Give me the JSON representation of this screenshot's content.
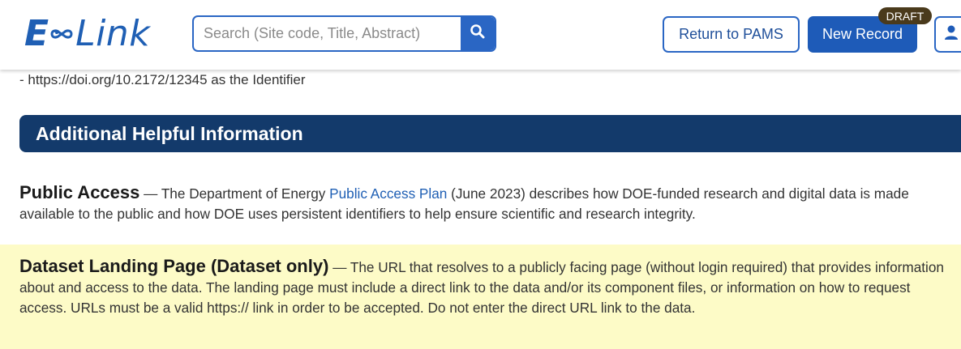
{
  "header": {
    "logo_e": "E",
    "logo_link": "Link",
    "search_placeholder": "Search (Site code, Title, Abstract)",
    "return_label": "Return to PAMS",
    "new_record_label": "New Record",
    "draft_badge": "DRAFT",
    "icons": [
      "infinity-logo-icon",
      "search-icon",
      "user-icon"
    ]
  },
  "content": {
    "doi_line": "- https://doi.org/10.2172/12345 as the Identifier",
    "section_title": "Additional Helpful Information",
    "public_access": {
      "term": "Public Access",
      "sep": " — ",
      "text_before": "The Department of Energy ",
      "link": "Public Access Plan",
      "text_after": " (June 2023) describes how DOE-funded research and digital data is made available to the public and how DOE uses persistent identifiers to help ensure scientific and research integrity."
    },
    "landing_page": {
      "term": "Dataset Landing Page (Dataset only)",
      "sep": " — ",
      "text": "The URL that resolves to a publicly facing page (without login required) that provides information about and access to the data. The landing page must include a direct link to the data and/or its component files, or information on how to request access. URLs must be a valid https:// link in order to be accepted. Do not enter the direct URL link to the data."
    },
    "colors": {
      "brand_blue": "#1f5fb4",
      "section_bar": "#133a6b",
      "highlight": "#fdfbc7",
      "badge": "#4a3a1c"
    }
  }
}
